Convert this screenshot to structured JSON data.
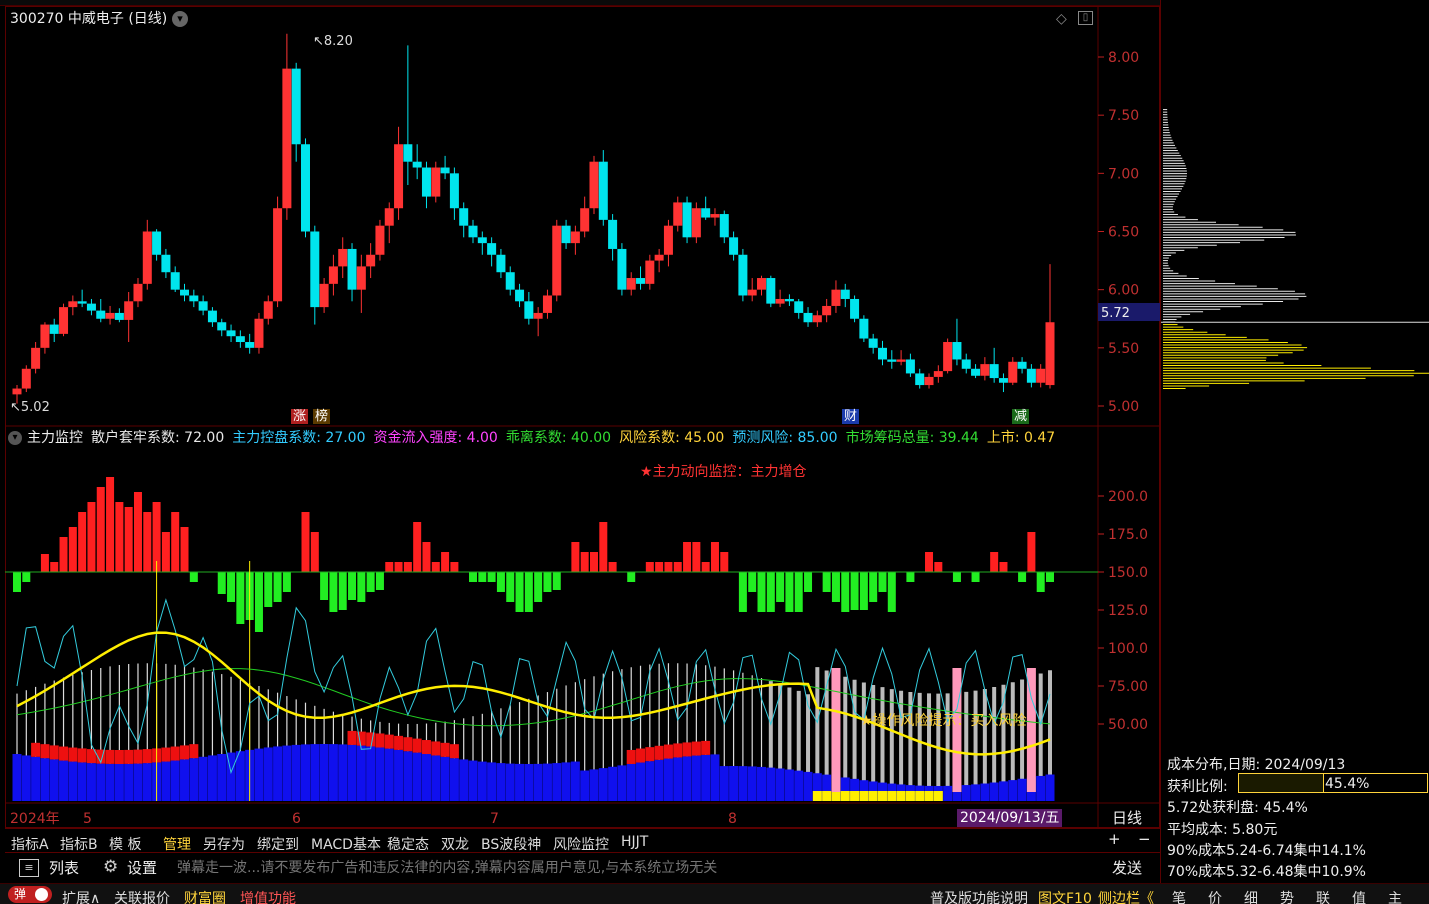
{
  "chart_header": {
    "stock_title": "300270 中威电子 (日线)"
  },
  "price_axis": {
    "ticks": [
      "8.00",
      "7.50",
      "7.00",
      "6.50",
      "6.00",
      "5.50",
      "5.00"
    ],
    "current_price": "5.72",
    "high_label": "8.20",
    "low_label": "5.02"
  },
  "event_markers": [
    {
      "label": "涨",
      "bg": "#b02020"
    },
    {
      "label": "榜",
      "bg": "#5a3a00"
    },
    {
      "label": "财",
      "bg": "#1a3aaa"
    },
    {
      "label": "减",
      "bg": "#1a6a1a"
    }
  ],
  "indicator_header": {
    "name": "主力监控",
    "items": [
      {
        "label": "散户套牢系数: 72.00",
        "color": "#e8e8e8"
      },
      {
        "label": "主力控盘系数: 27.00",
        "color": "#33ccff"
      },
      {
        "label": "资金流入强度: 4.00",
        "color": "#ff44ff"
      },
      {
        "label": "乖离系数: 40.00",
        "color": "#33dd33"
      },
      {
        "label": "风险系数: 45.00",
        "color": "#ffd43b"
      },
      {
        "label": "预测风险: 85.00",
        "color": "#33ccff"
      },
      {
        "label": "市场筹码总量: 39.44",
        "color": "#33dd33"
      },
      {
        "label": "上市: 0.47",
        "color": "#ffd43b"
      }
    ],
    "alert": "★主力动向监控：主力增仓",
    "risk_note": "★操作风险提示：买入风险"
  },
  "indicator_axis": {
    "ticks": [
      "200.0",
      "175.0",
      "150.0",
      "125.0",
      "100.0",
      "75.00",
      "50.00"
    ]
  },
  "date_axis": {
    "year": "2024年",
    "months": [
      "5",
      "6",
      "7",
      "8"
    ],
    "current_date": "2024/09/13/五",
    "period": "日线"
  },
  "tabs": [
    {
      "label": "指标A",
      "active": false
    },
    {
      "label": "指标B",
      "active": false
    },
    {
      "label": "模 板",
      "active": false
    },
    {
      "label": "管理",
      "active": true
    },
    {
      "label": "另存为",
      "active": false
    },
    {
      "label": "绑定到",
      "active": false
    },
    {
      "label": "MACD基本",
      "active": false
    },
    {
      "label": "稳定态",
      "active": false
    },
    {
      "label": "双龙",
      "active": false
    },
    {
      "label": "BS波段神",
      "active": false
    },
    {
      "label": "风险监控",
      "active": false
    },
    {
      "label": "HJJT",
      "active": false
    }
  ],
  "barrage": {
    "list_label": "列表",
    "settings_label": "设置",
    "placeholder": "弹幕走一波...请不要发布广告和违反法律的内容,弹幕内容属用户意见,与本系统立场无关",
    "send_label": "发送",
    "plus": "+",
    "minus": "−"
  },
  "status_bar": {
    "toggle_label": "弹",
    "expand_label": "扩展∧",
    "related_quotes": "关联报价",
    "wealth_circle": "财富圈",
    "value_added": "增值功能",
    "popular_help": "普及版功能说明",
    "f10_link": "图文F10",
    "sidebar_link": "侧边栏《",
    "right_tabs": [
      "笔",
      "价",
      "细",
      "势",
      "联",
      "值",
      "主"
    ]
  },
  "chip_distribution": {
    "date_line": "成本分布,日期: 2024/09/13",
    "profit_ratio_label": "获利比例:",
    "profit_ratio_value": "45.4%",
    "profit_ratio_fraction": 0.454,
    "profit_at_price": "5.72处获利盘: 45.4%",
    "avg_cost": "平均成本: 5.80元",
    "cost_90": "90%成本5.24-6.74集中14.1%",
    "cost_70": "70%成本5.32-6.48集中10.9%"
  },
  "chart_data": {
    "type": "candlestick",
    "title": "300270 中威电子 (日线)",
    "ylim": [
      4.85,
      8.45
    ],
    "ohlc": [
      [
        5.1,
        5.18,
        5.02,
        5.15
      ],
      [
        5.15,
        5.35,
        5.12,
        5.32
      ],
      [
        5.32,
        5.55,
        5.28,
        5.5
      ],
      [
        5.5,
        5.72,
        5.45,
        5.7
      ],
      [
        5.7,
        5.75,
        5.55,
        5.62
      ],
      [
        5.62,
        5.88,
        5.6,
        5.85
      ],
      [
        5.85,
        5.95,
        5.78,
        5.9
      ],
      [
        5.9,
        6.0,
        5.85,
        5.88
      ],
      [
        5.88,
        5.92,
        5.78,
        5.82
      ],
      [
        5.82,
        5.92,
        5.72,
        5.75
      ],
      [
        5.75,
        5.86,
        5.7,
        5.8
      ],
      [
        5.8,
        5.84,
        5.72,
        5.74
      ],
      [
        5.74,
        5.98,
        5.55,
        5.9
      ],
      [
        5.9,
        6.1,
        5.85,
        6.05
      ],
      [
        6.05,
        6.6,
        6.0,
        6.5
      ],
      [
        6.5,
        6.52,
        6.25,
        6.3
      ],
      [
        6.3,
        6.35,
        6.1,
        6.15
      ],
      [
        6.15,
        6.2,
        5.98,
        6.0
      ],
      [
        6.0,
        6.05,
        5.9,
        5.95
      ],
      [
        5.95,
        6.0,
        5.85,
        5.9
      ],
      [
        5.9,
        5.95,
        5.78,
        5.82
      ],
      [
        5.82,
        5.85,
        5.68,
        5.72
      ],
      [
        5.72,
        5.75,
        5.6,
        5.65
      ],
      [
        5.65,
        5.7,
        5.55,
        5.6
      ],
      [
        5.6,
        5.65,
        5.5,
        5.55
      ],
      [
        5.55,
        5.62,
        5.45,
        5.5
      ],
      [
        5.5,
        5.8,
        5.45,
        5.75
      ],
      [
        5.75,
        5.95,
        5.7,
        5.9
      ],
      [
        5.9,
        6.8,
        5.85,
        6.7
      ],
      [
        6.7,
        8.2,
        6.6,
        7.9
      ],
      [
        7.9,
        7.95,
        7.1,
        7.25
      ],
      [
        7.25,
        7.3,
        6.45,
        6.5
      ],
      [
        6.5,
        6.55,
        5.7,
        5.85
      ],
      [
        5.85,
        6.1,
        5.8,
        6.05
      ],
      [
        6.05,
        6.3,
        5.95,
        6.2
      ],
      [
        6.2,
        6.45,
        6.1,
        6.35
      ],
      [
        6.35,
        6.4,
        5.9,
        6.0
      ],
      [
        6.0,
        6.3,
        5.8,
        6.2
      ],
      [
        6.2,
        6.4,
        6.1,
        6.3
      ],
      [
        6.3,
        6.6,
        6.25,
        6.55
      ],
      [
        6.55,
        6.75,
        6.4,
        6.7
      ],
      [
        6.7,
        7.4,
        6.6,
        7.25
      ],
      [
        7.25,
        8.1,
        6.9,
        7.1
      ],
      [
        7.1,
        7.25,
        6.95,
        7.05
      ],
      [
        7.05,
        7.1,
        6.7,
        6.8
      ],
      [
        6.8,
        7.1,
        6.75,
        7.05
      ],
      [
        7.05,
        7.15,
        6.95,
        7.0
      ],
      [
        7.0,
        7.05,
        6.6,
        6.7
      ],
      [
        6.7,
        6.75,
        6.45,
        6.55
      ],
      [
        6.55,
        6.6,
        6.4,
        6.45
      ],
      [
        6.45,
        6.5,
        6.3,
        6.4
      ],
      [
        6.4,
        6.45,
        6.2,
        6.3
      ],
      [
        6.3,
        6.35,
        6.1,
        6.15
      ],
      [
        6.15,
        6.2,
        5.95,
        6.0
      ],
      [
        6.0,
        6.05,
        5.85,
        5.9
      ],
      [
        5.9,
        5.98,
        5.7,
        5.75
      ],
      [
        5.75,
        5.85,
        5.6,
        5.8
      ],
      [
        5.8,
        6.0,
        5.75,
        5.95
      ],
      [
        5.95,
        6.6,
        5.9,
        6.55
      ],
      [
        6.55,
        6.6,
        6.35,
        6.4
      ],
      [
        6.4,
        6.55,
        6.3,
        6.5
      ],
      [
        6.5,
        6.8,
        6.45,
        6.7
      ],
      [
        6.7,
        7.15,
        6.65,
        7.1
      ],
      [
        7.1,
        7.2,
        6.55,
        6.6
      ],
      [
        6.6,
        6.65,
        6.25,
        6.35
      ],
      [
        6.35,
        6.4,
        5.95,
        6.0
      ],
      [
        6.0,
        6.15,
        5.95,
        6.1
      ],
      [
        6.1,
        6.2,
        6.0,
        6.05
      ],
      [
        6.05,
        6.3,
        6.0,
        6.25
      ],
      [
        6.25,
        6.35,
        6.15,
        6.3
      ],
      [
        6.3,
        6.6,
        6.2,
        6.55
      ],
      [
        6.55,
        6.8,
        6.5,
        6.75
      ],
      [
        6.75,
        6.8,
        6.4,
        6.45
      ],
      [
        6.45,
        6.75,
        6.4,
        6.7
      ],
      [
        6.7,
        6.8,
        6.6,
        6.62
      ],
      [
        6.62,
        6.7,
        6.55,
        6.65
      ],
      [
        6.65,
        6.68,
        6.4,
        6.45
      ],
      [
        6.45,
        6.5,
        6.25,
        6.3
      ],
      [
        6.3,
        6.35,
        5.9,
        5.95
      ],
      [
        5.95,
        6.1,
        5.9,
        6.0
      ],
      [
        6.0,
        6.12,
        5.95,
        6.1
      ],
      [
        6.1,
        6.12,
        5.85,
        5.88
      ],
      [
        5.88,
        6.0,
        5.85,
        5.92
      ],
      [
        5.92,
        5.96,
        5.86,
        5.9
      ],
      [
        5.9,
        5.92,
        5.75,
        5.8
      ],
      [
        5.8,
        5.85,
        5.68,
        5.72
      ],
      [
        5.72,
        5.82,
        5.68,
        5.78
      ],
      [
        5.78,
        5.92,
        5.72,
        5.86
      ],
      [
        5.86,
        6.08,
        5.8,
        6.0
      ],
      [
        6.0,
        6.05,
        5.85,
        5.92
      ],
      [
        5.92,
        5.95,
        5.72,
        5.75
      ],
      [
        5.75,
        5.78,
        5.55,
        5.58
      ],
      [
        5.58,
        5.62,
        5.45,
        5.5
      ],
      [
        5.5,
        5.56,
        5.35,
        5.4
      ],
      [
        5.4,
        5.48,
        5.32,
        5.38
      ],
      [
        5.38,
        5.48,
        5.35,
        5.4
      ],
      [
        5.4,
        5.45,
        5.25,
        5.28
      ],
      [
        5.28,
        5.32,
        5.15,
        5.18
      ],
      [
        5.18,
        5.28,
        5.15,
        5.25
      ],
      [
        5.25,
        5.35,
        5.2,
        5.3
      ],
      [
        5.3,
        5.58,
        5.28,
        5.55
      ],
      [
        5.55,
        5.75,
        5.35,
        5.4
      ],
      [
        5.4,
        5.45,
        5.28,
        5.32
      ],
      [
        5.32,
        5.36,
        5.24,
        5.26
      ],
      [
        5.26,
        5.42,
        5.22,
        5.36
      ],
      [
        5.36,
        5.5,
        5.2,
        5.24
      ],
      [
        5.24,
        5.28,
        5.12,
        5.2
      ],
      [
        5.2,
        5.42,
        5.18,
        5.38
      ],
      [
        5.38,
        5.42,
        5.28,
        5.32
      ],
      [
        5.32,
        5.36,
        5.16,
        5.2
      ],
      [
        5.2,
        5.36,
        5.16,
        5.32
      ],
      [
        5.18,
        6.22,
        5.15,
        5.72
      ]
    ]
  }
}
